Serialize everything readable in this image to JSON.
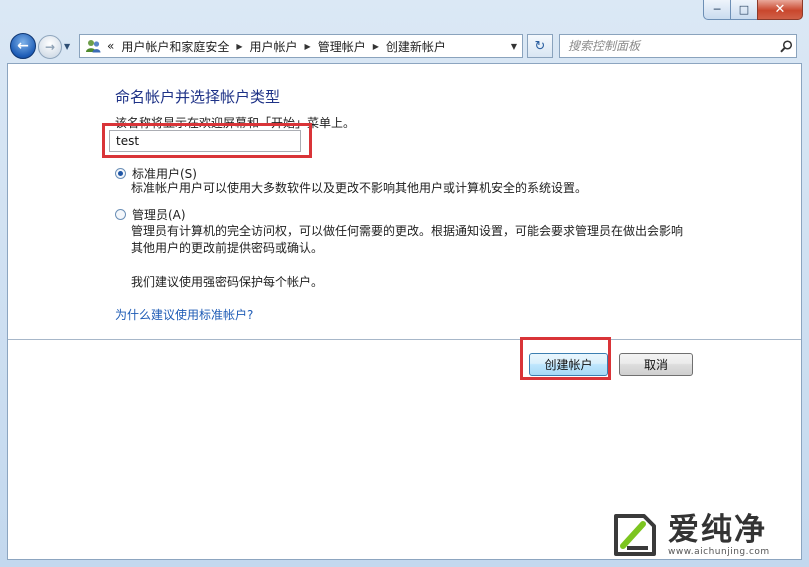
{
  "window": {
    "minimize_glyph": "─",
    "maximize_glyph": "□",
    "close_glyph": "✕"
  },
  "nav": {
    "back_glyph": "←",
    "forward_glyph": "→",
    "recent_glyph": "▼",
    "address_icon": "users-icon",
    "overflow": "«",
    "breadcrumbs": [
      "用户帐户和家庭安全",
      "用户帐户",
      "管理帐户",
      "创建新帐户"
    ],
    "refresh_glyph": "↻",
    "search_placeholder": "搜索控制面板"
  },
  "main": {
    "title": "命名帐户并选择帐户类型",
    "subtitle": "该名称将显示在欢迎屏幕和「开始」菜单上。",
    "account_name": "test",
    "options": [
      {
        "label": "标准用户(S)",
        "selected": true,
        "description": [
          "标准帐户用户可以使用大多数软件以及更改不影响其他用户或计算机安全的系统设置。"
        ]
      },
      {
        "label": "管理员(A)",
        "selected": false,
        "description": [
          "管理员有计算机的完全访问权，可以做任何需要的更改。根据通知设置，可能会要求管理员在做出会影响",
          "其他用户的更改前提供密码或确认。",
          "",
          "我们建议使用强密码保护每个帐户。"
        ]
      }
    ],
    "help_link": "为什么建议使用标准帐户?",
    "create_button": "创建帐户",
    "cancel_button": "取消"
  },
  "watermark": {
    "brand": "爱纯净",
    "url": "www.aichunjing.com"
  },
  "colors": {
    "title": "#1e3287",
    "link": "#1f5cb6",
    "highlight": "#d93438"
  }
}
